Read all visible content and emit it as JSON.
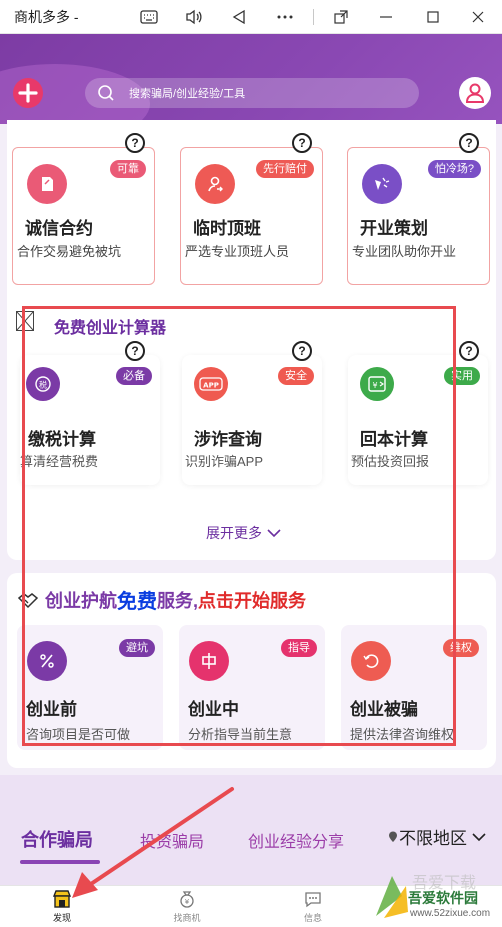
{
  "window": {
    "title": "商机多多 -",
    "controls": [
      "keyboard-icon",
      "volume-icon",
      "back-icon",
      "more-icon",
      "popout-icon",
      "minimize-icon",
      "maximize-icon",
      "close-icon"
    ]
  },
  "header": {
    "search_placeholder": "搜索骗局/创业经验/工具",
    "colors": {
      "primary": "#7d3ca4",
      "accent": "#e8396a"
    }
  },
  "top_cards": [
    {
      "title": "诚信合约",
      "subtitle": "合作交易避免被坑",
      "badge": "可靠",
      "icon": "contract-icon"
    },
    {
      "title": "临时顶班",
      "subtitle": "严选专业顶班人员",
      "badge": "先行赔付",
      "icon": "shift-icon"
    },
    {
      "title": "开业策划",
      "subtitle": "专业团队助你开业",
      "badge": "怕冷场?",
      "icon": "opening-icon"
    }
  ],
  "calculator": {
    "title": "免费创业计算器",
    "cards": [
      {
        "title": "缴税计算",
        "subtitle": "算清经营税费",
        "badge": "必备",
        "icon": "tax-icon"
      },
      {
        "title": "涉诈查询",
        "subtitle": "识别诈骗APP",
        "badge": "安全",
        "icon": "app-check-icon"
      },
      {
        "title": "回本计算",
        "subtitle": "预估投资回报",
        "badge": "实用",
        "icon": "payback-icon"
      }
    ],
    "expand_label": "展开更多"
  },
  "guard": {
    "title_a": "创业护航",
    "title_b": "免费",
    "title_c": "服务,",
    "title_d": "点击开始服务",
    "cards": [
      {
        "title": "创业前",
        "subtitle": "咨询项目是否可做",
        "badge": "避坑",
        "icon": "percent-icon"
      },
      {
        "title": "创业中",
        "subtitle": "分析指导当前生意",
        "badge": "指导",
        "icon": "middle-icon"
      },
      {
        "title": "创业被骗",
        "subtitle": "提供法律咨询维权",
        "badge": "维权",
        "icon": "restore-icon"
      }
    ]
  },
  "tabs": [
    {
      "label": "合作骗局",
      "active": true
    },
    {
      "label": "投资骗局",
      "active": false
    },
    {
      "label": "创业经验分享",
      "active": false
    }
  ],
  "region": "不限地区",
  "bottom_nav": [
    {
      "label": "发现",
      "icon": "shop-icon",
      "active": true
    },
    {
      "label": "找商机",
      "icon": "money-bag-icon",
      "active": false
    },
    {
      "label": "信息",
      "icon": "message-icon",
      "active": false
    }
  ],
  "watermark": {
    "title": "吾爱软件园",
    "url": "www.52zixue.com"
  }
}
